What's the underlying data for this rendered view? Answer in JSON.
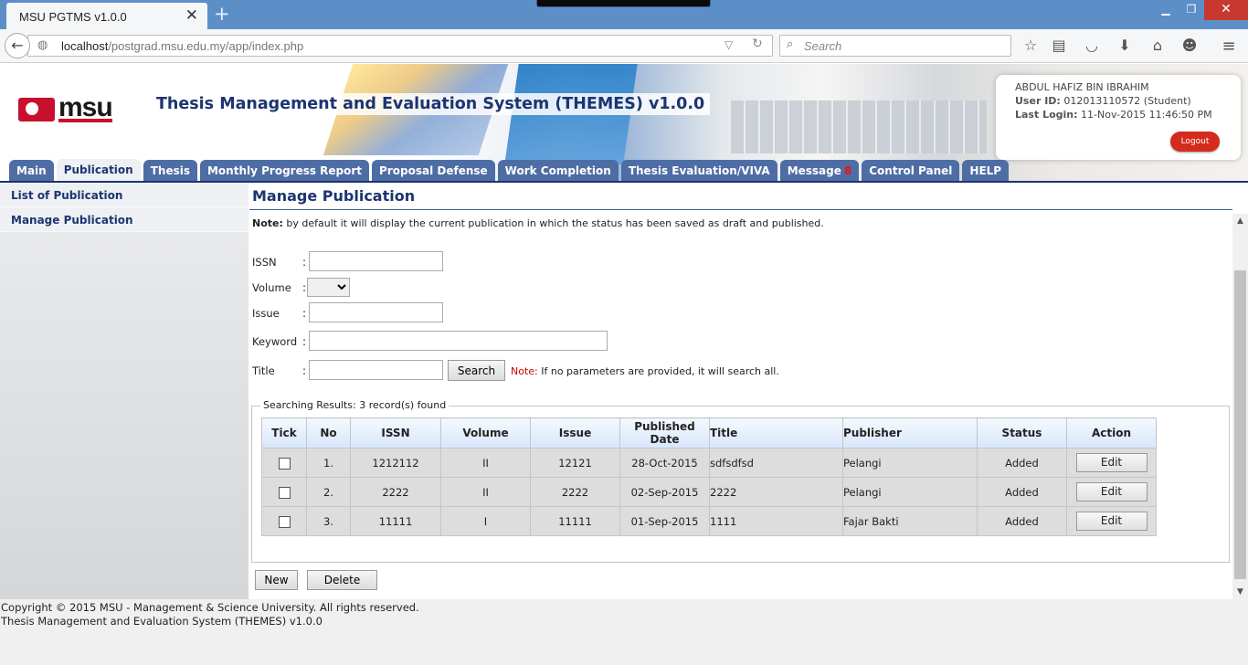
{
  "browser": {
    "tab_title": "MSU PGTMS v1.0.0",
    "url_host": "localhost",
    "url_path": "/postgrad.msu.edu.my/app/index.php",
    "search_placeholder": "Search"
  },
  "header": {
    "logo_text": "msu",
    "system_title": "Thesis Management and Evaluation System (THEMES) v1.0.0",
    "user_name": "ABDUL HAFIZ BIN IBRAHIM",
    "user_id_label": "User ID:",
    "user_id_value": "012013110572 (Student)",
    "last_login_label": "Last Login:",
    "last_login_value": "11-Nov-2015 11:46:50 PM",
    "logout_label": "Logout"
  },
  "menu": [
    {
      "label": "Main"
    },
    {
      "label": "Publication"
    },
    {
      "label": "Thesis"
    },
    {
      "label": "Monthly Progress Report"
    },
    {
      "label": "Proposal Defense"
    },
    {
      "label": "Work Completion"
    },
    {
      "label": "Thesis Evaluation/VIVA"
    },
    {
      "label": "Message",
      "badge": "8"
    },
    {
      "label": "Control Panel"
    },
    {
      "label": "HELP"
    }
  ],
  "sidebar": {
    "items": [
      {
        "label": "List of Publication"
      },
      {
        "label": "Manage Publication"
      }
    ]
  },
  "main": {
    "title": "Manage Publication",
    "note_label": "Note:",
    "note_text": "by default it will display the current publication in which the status has been saved as draft and published.",
    "form": {
      "issn_label": "ISSN",
      "volume_label": "Volume",
      "issue_label": "Issue",
      "keyword_label": "Keyword",
      "title_label": "Title",
      "colon": ":",
      "search_button": "Search",
      "search_note_label": "Note:",
      "search_note_text": "If no parameters are provided, it will search all."
    },
    "results": {
      "legend": "Searching Results: 3 record(s) found",
      "headers": [
        "Tick",
        "No",
        "ISSN",
        "Volume",
        "Issue",
        "Published Date",
        "Title",
        "Publisher",
        "Status",
        "Action"
      ],
      "rows": [
        {
          "no": "1.",
          "issn": "1212112",
          "volume": "II",
          "issue": "12121",
          "date": "28-Oct-2015",
          "title": "sdfsdfsd",
          "publisher": "Pelangi",
          "status": "Added",
          "action": "Edit"
        },
        {
          "no": "2.",
          "issn": "2222",
          "volume": "II",
          "issue": "2222",
          "date": "02-Sep-2015",
          "title": "2222",
          "publisher": "Pelangi",
          "status": "Added",
          "action": "Edit"
        },
        {
          "no": "3.",
          "issn": "11111",
          "volume": "I",
          "issue": "11111",
          "date": "01-Sep-2015",
          "title": "1111",
          "publisher": "Fajar Bakti",
          "status": "Added",
          "action": "Edit"
        }
      ]
    },
    "new_button": "New",
    "delete_button": "Delete"
  },
  "footer": {
    "line1": "Copyright © 2015 MSU - Management & Science University. All rights reserved.",
    "line2": "Thesis Management and Evaluation System (THEMES) v1.0.0"
  },
  "colors": {
    "brand_navy": "#1c3570",
    "tab_blue": "#4e6da5",
    "logout_red": "#d42b1e",
    "note_red": "#cc0000"
  }
}
